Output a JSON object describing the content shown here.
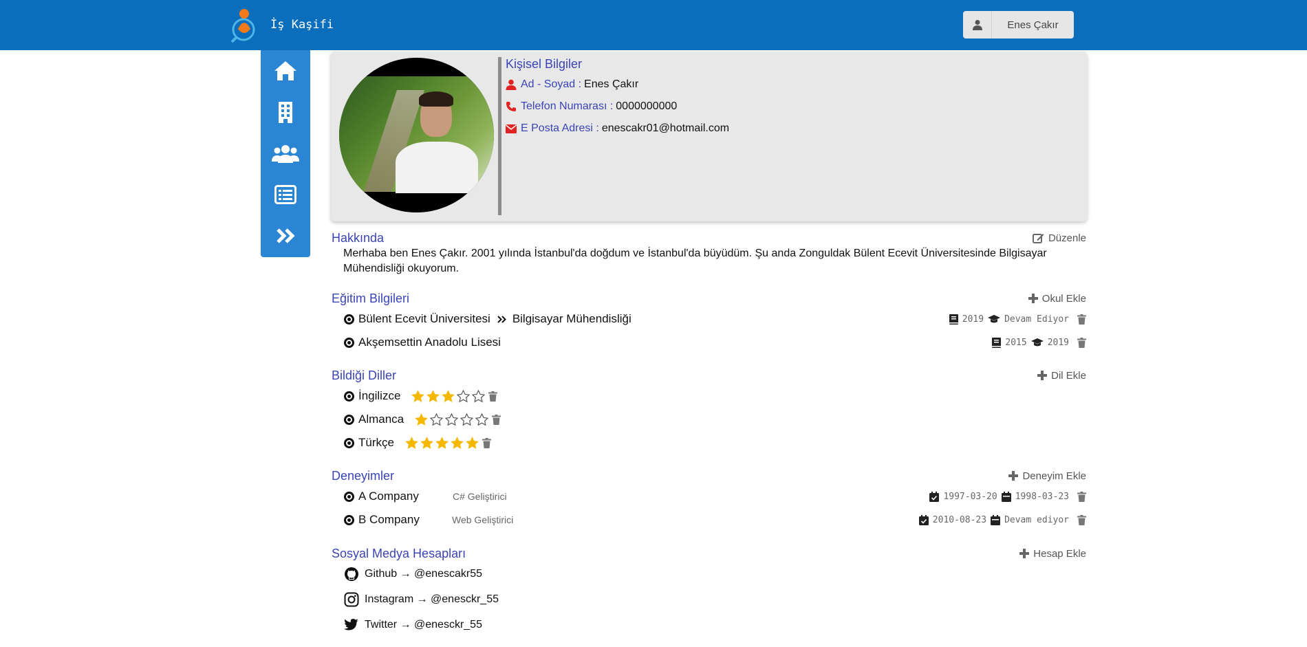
{
  "header": {
    "brand": "İş Kaşifi",
    "user": "Enes Çakır"
  },
  "colors": {
    "header": "#0a6ebd",
    "sidebar": "#2a86d4",
    "title": "#3a44b8",
    "icon_red": "#e02424",
    "star": "#f5b800"
  },
  "sidebar": {
    "items": [
      {
        "icon": "home-icon"
      },
      {
        "icon": "building-icon"
      },
      {
        "icon": "users-icon"
      },
      {
        "icon": "list-icon"
      },
      {
        "icon": "chevrons-right-icon"
      }
    ]
  },
  "personal": {
    "title": "Kişisel Bilgiler",
    "name_label": "Ad - Soyad :",
    "name": "Enes Çakır",
    "phone_label": "Telefon Numarası :",
    "phone": "0000000000",
    "email_label": "E Posta Adresi :",
    "email": "enescakr01@hotmail.com"
  },
  "about": {
    "title": "Hakkında",
    "action": "Düzenle",
    "text": "Merhaba ben Enes Çakır. 2001 yılında İstanbul'da doğdum ve İstanbul'da büyüdüm. Şu anda Zonguldak Bülent Ecevit Üniversitesinde Bilgisayar Mühendisliği okuyorum."
  },
  "education": {
    "title": "Eğitim Bilgileri",
    "action": "Okul Ekle",
    "items": [
      {
        "school": "Bülent Ecevit Üniversitesi",
        "department": "Bilgisayar Mühendisliği",
        "start": "2019",
        "end": "Devam Ediyor"
      },
      {
        "school": "Akşemsettin Anadolu Lisesi",
        "department": "",
        "start": "2015",
        "end": "2019"
      }
    ]
  },
  "languages": {
    "title": "Bildiği Diller",
    "action": "Dil Ekle",
    "items": [
      {
        "name": "İngilizce",
        "level": 3
      },
      {
        "name": "Almanca",
        "level": 1
      },
      {
        "name": "Türkçe",
        "level": 5
      }
    ]
  },
  "experience": {
    "title": "Deneyimler",
    "action": "Deneyim Ekle",
    "items": [
      {
        "company": "A Company",
        "role": "C# Geliştirici",
        "start": "1997-03-20",
        "end": "1998-03-23"
      },
      {
        "company": "B Company",
        "role": "Web Geliştirici",
        "start": "2010-08-23",
        "end": "Devam ediyor"
      }
    ]
  },
  "social": {
    "title": "Sosyal Medya Hesapları",
    "action": "Hesap Ekle",
    "items": [
      {
        "label": "Github → @enescakr55",
        "icon": "github-icon"
      },
      {
        "label": "Instagram → @enesckr_55",
        "icon": "instagram-icon"
      },
      {
        "label": "Twitter → @enesckr_55",
        "icon": "twitter-icon"
      }
    ]
  }
}
